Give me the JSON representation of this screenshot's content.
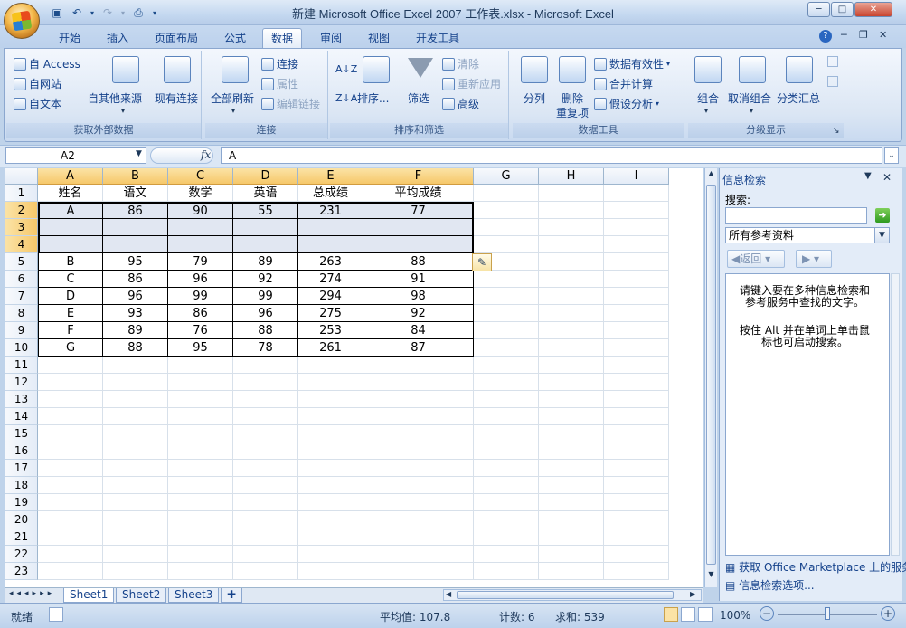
{
  "window": {
    "title": "新建 Microsoft Office Excel 2007 工作表.xlsx - Microsoft Excel",
    "min": "─",
    "max": "□",
    "close": "✕"
  },
  "qat": {
    "save_icon": "save-icon",
    "undo_icon": "undo-icon",
    "redo_icon": "redo-icon",
    "preview_icon": "print-preview-icon"
  },
  "tabs": [
    "开始",
    "插入",
    "页面布局",
    "公式",
    "数据",
    "审阅",
    "视图",
    "开发工具"
  ],
  "active_tab": "数据",
  "ribbon": {
    "external": {
      "access": "自 Access",
      "web": "自网站",
      "text": "自文本",
      "other": "自其他来源",
      "existing": "现有连接",
      "label": "获取外部数据"
    },
    "connections": {
      "refresh_all": "全部刷新",
      "connections": "连接",
      "properties": "属性",
      "edit_links": "编辑链接",
      "label": "连接"
    },
    "sortfilter": {
      "sort": "排序...",
      "filter": "筛选",
      "clear": "清除",
      "reapply": "重新应用",
      "advanced": "高级",
      "label": "排序和筛选"
    },
    "datatools": {
      "text_to_columns": "分列",
      "remove_dup_1": "删除",
      "remove_dup_2": "重复项",
      "validation": "数据有效性",
      "consolidate": "合并计算",
      "whatif": "假设分析",
      "label": "数据工具"
    },
    "outline": {
      "group": "组合",
      "ungroup": "取消组合",
      "subtotal": "分类汇总",
      "label": "分级显示"
    }
  },
  "formula_bar": {
    "name_box": "A2",
    "fx": "fx",
    "formula": "A"
  },
  "columns": [
    "A",
    "B",
    "C",
    "D",
    "E",
    "F",
    "G",
    "H",
    "I"
  ],
  "rows": [
    "1",
    "2",
    "3",
    "4",
    "5",
    "6",
    "7",
    "8",
    "9",
    "10",
    "11",
    "12",
    "13",
    "14",
    "15",
    "16",
    "17",
    "18",
    "19",
    "20",
    "21",
    "22",
    "23"
  ],
  "table": {
    "header": [
      "姓名",
      "语文",
      "数学",
      "英语",
      "总成绩",
      "平均成绩"
    ],
    "rows": [
      [
        "A",
        "86",
        "90",
        "55",
        "231",
        "77"
      ],
      [
        "",
        "",
        "",
        "",
        "",
        ""
      ],
      [
        "",
        "",
        "",
        "",
        "",
        ""
      ],
      [
        "B",
        "95",
        "79",
        "89",
        "263",
        "88"
      ],
      [
        "C",
        "86",
        "96",
        "92",
        "274",
        "91"
      ],
      [
        "D",
        "96",
        "99",
        "99",
        "294",
        "98"
      ],
      [
        "E",
        "93",
        "86",
        "96",
        "275",
        "92"
      ],
      [
        "F",
        "89",
        "76",
        "88",
        "253",
        "84"
      ],
      [
        "G",
        "88",
        "95",
        "78",
        "261",
        "87"
      ]
    ]
  },
  "sheets": [
    "Sheet1",
    "Sheet2",
    "Sheet3"
  ],
  "status": {
    "ready": "就绪",
    "average": "平均值: 107.8",
    "count": "计数: 6",
    "sum": "求和: 539",
    "zoom": "100%"
  },
  "research_pane": {
    "title": "信息检索",
    "search_label": "搜索:",
    "search_value": "",
    "source": "所有参考资料",
    "back": "返回",
    "message_1": "请键入要在多种信息检索和参考服务中查找的文字。",
    "message_2": "按住 Alt 并在单词上单击鼠标也可启动搜索。",
    "footer_1": "获取 Office Marketplace 上的服务",
    "footer_2": "信息检索选项..."
  }
}
